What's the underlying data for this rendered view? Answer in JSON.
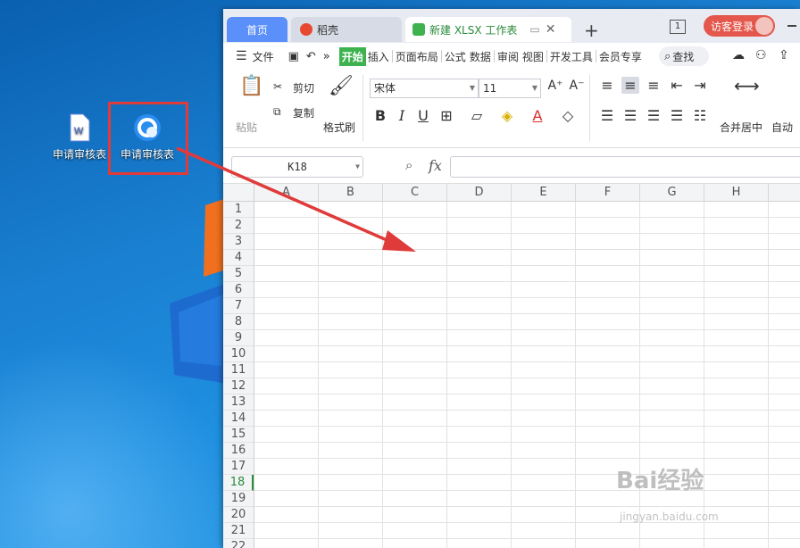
{
  "desktop": {
    "icons": [
      {
        "label": "申请审核表",
        "icon": "wps-writer-doc-icon"
      },
      {
        "label": "申请审核表",
        "icon": "wps-cloud-shortcut-icon"
      }
    ]
  },
  "app": {
    "tabs": [
      {
        "label": "首页"
      },
      {
        "label": "稻壳"
      },
      {
        "label": "新建 XLSX 工作表"
      }
    ],
    "tab_count_badge": "1",
    "login_label": "访客登录",
    "menu": {
      "file": "文件",
      "items": [
        "开始",
        "插入",
        "页面布局",
        "公式",
        "数据",
        "审阅",
        "视图",
        "开发工具",
        "会员专享"
      ],
      "active": "开始",
      "search": "查找"
    },
    "ribbon": {
      "paste": "粘贴",
      "cut": "剪切",
      "copy": "复制",
      "format_painter": "格式刷",
      "font_name": "宋体",
      "font_size": "11",
      "merge_center": "合并居中",
      "auto_wrap": "自动"
    },
    "formula_bar": {
      "name_box": "K18",
      "fx": "fx",
      "value": ""
    },
    "sheet": {
      "columns": [
        "A",
        "B",
        "C",
        "D",
        "E",
        "F",
        "G",
        "H"
      ],
      "rows": [
        "1",
        "2",
        "3",
        "4",
        "5",
        "6",
        "7",
        "8",
        "9",
        "10",
        "11",
        "12",
        "13",
        "14",
        "15",
        "16",
        "17",
        "18",
        "19",
        "20",
        "21",
        "22"
      ],
      "current_row": "18"
    }
  },
  "watermark": {
    "brand": "Bai经验",
    "url": "jingyan.baidu.com"
  },
  "colors": {
    "accent_green": "#3db24f",
    "home_tab": "#5b8ff9",
    "login": "#e4574c",
    "annotation_red": "#e03b3b"
  }
}
